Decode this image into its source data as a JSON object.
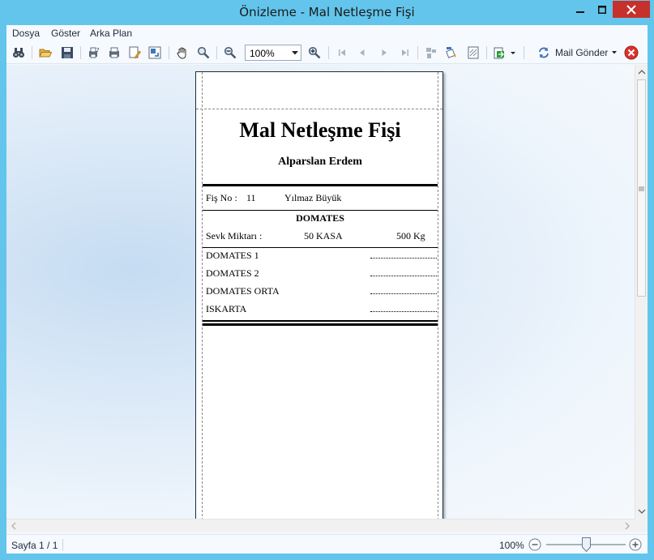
{
  "window": {
    "title": "Önizleme - Mal Netleşme Fişi"
  },
  "menu": {
    "items": [
      "Dosya",
      "Göster",
      "Arka Plan"
    ]
  },
  "toolbar": {
    "zoom_value": "100%",
    "mail_label": "Mail Gönder"
  },
  "document": {
    "title": "Mal Netleşme Fişi",
    "subtitle": "Alparslan Erdem",
    "fis_no_label": "Fiş No :",
    "fis_no_value": "11",
    "customer": "Yılmaz Büyük",
    "product": "DOMATES",
    "sevk_label": "Sevk Miktarı :",
    "sevk_kasa": "50 KASA",
    "sevk_kg": "500 Kg",
    "lines": [
      "DOMATES 1",
      "DOMATES 2",
      "DOMATES ORTA",
      "ISKARTA"
    ]
  },
  "status": {
    "page": "Sayfa 1 / 1",
    "zoom": "100%",
    "zoom_slider": 0.5
  },
  "colors": {
    "frame": "#63c5ec",
    "close": "#c7312b",
    "mail_close": "#d9342b"
  }
}
